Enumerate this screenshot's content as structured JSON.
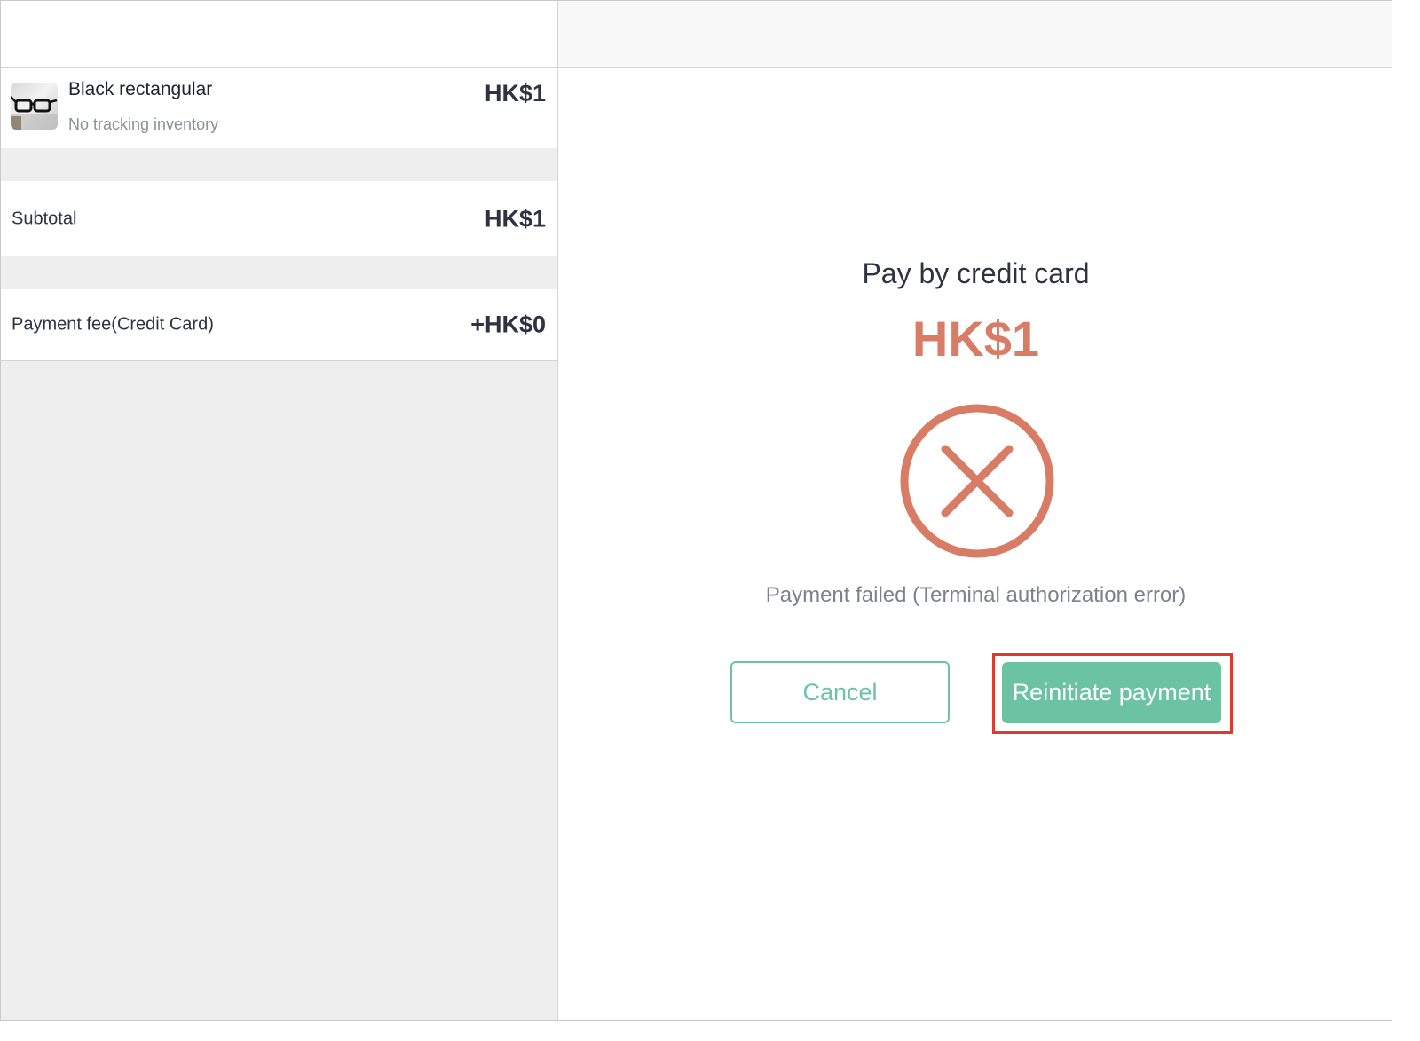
{
  "cart": {
    "item": {
      "name": "Black rectangular",
      "subtitle": "No tracking inventory",
      "price": "HK$1",
      "thumbnail_icon": "glasses-icon"
    },
    "subtotal": {
      "label": "Subtotal",
      "value": "HK$1"
    },
    "payment_fee": {
      "label": "Payment fee(Credit Card)",
      "value": "+HK$0"
    }
  },
  "payment": {
    "title": "Pay by credit card",
    "amount": "HK$1",
    "status_icon": "error-x-icon",
    "status_message": "Payment failed (Terminal authorization error)",
    "cancel_label": "Cancel",
    "reinitiate_label": "Reinitiate payment"
  },
  "colors": {
    "accent_green": "#6cc3a3",
    "error_salmon": "#d87c66",
    "highlight_red": "#e03a2e"
  }
}
